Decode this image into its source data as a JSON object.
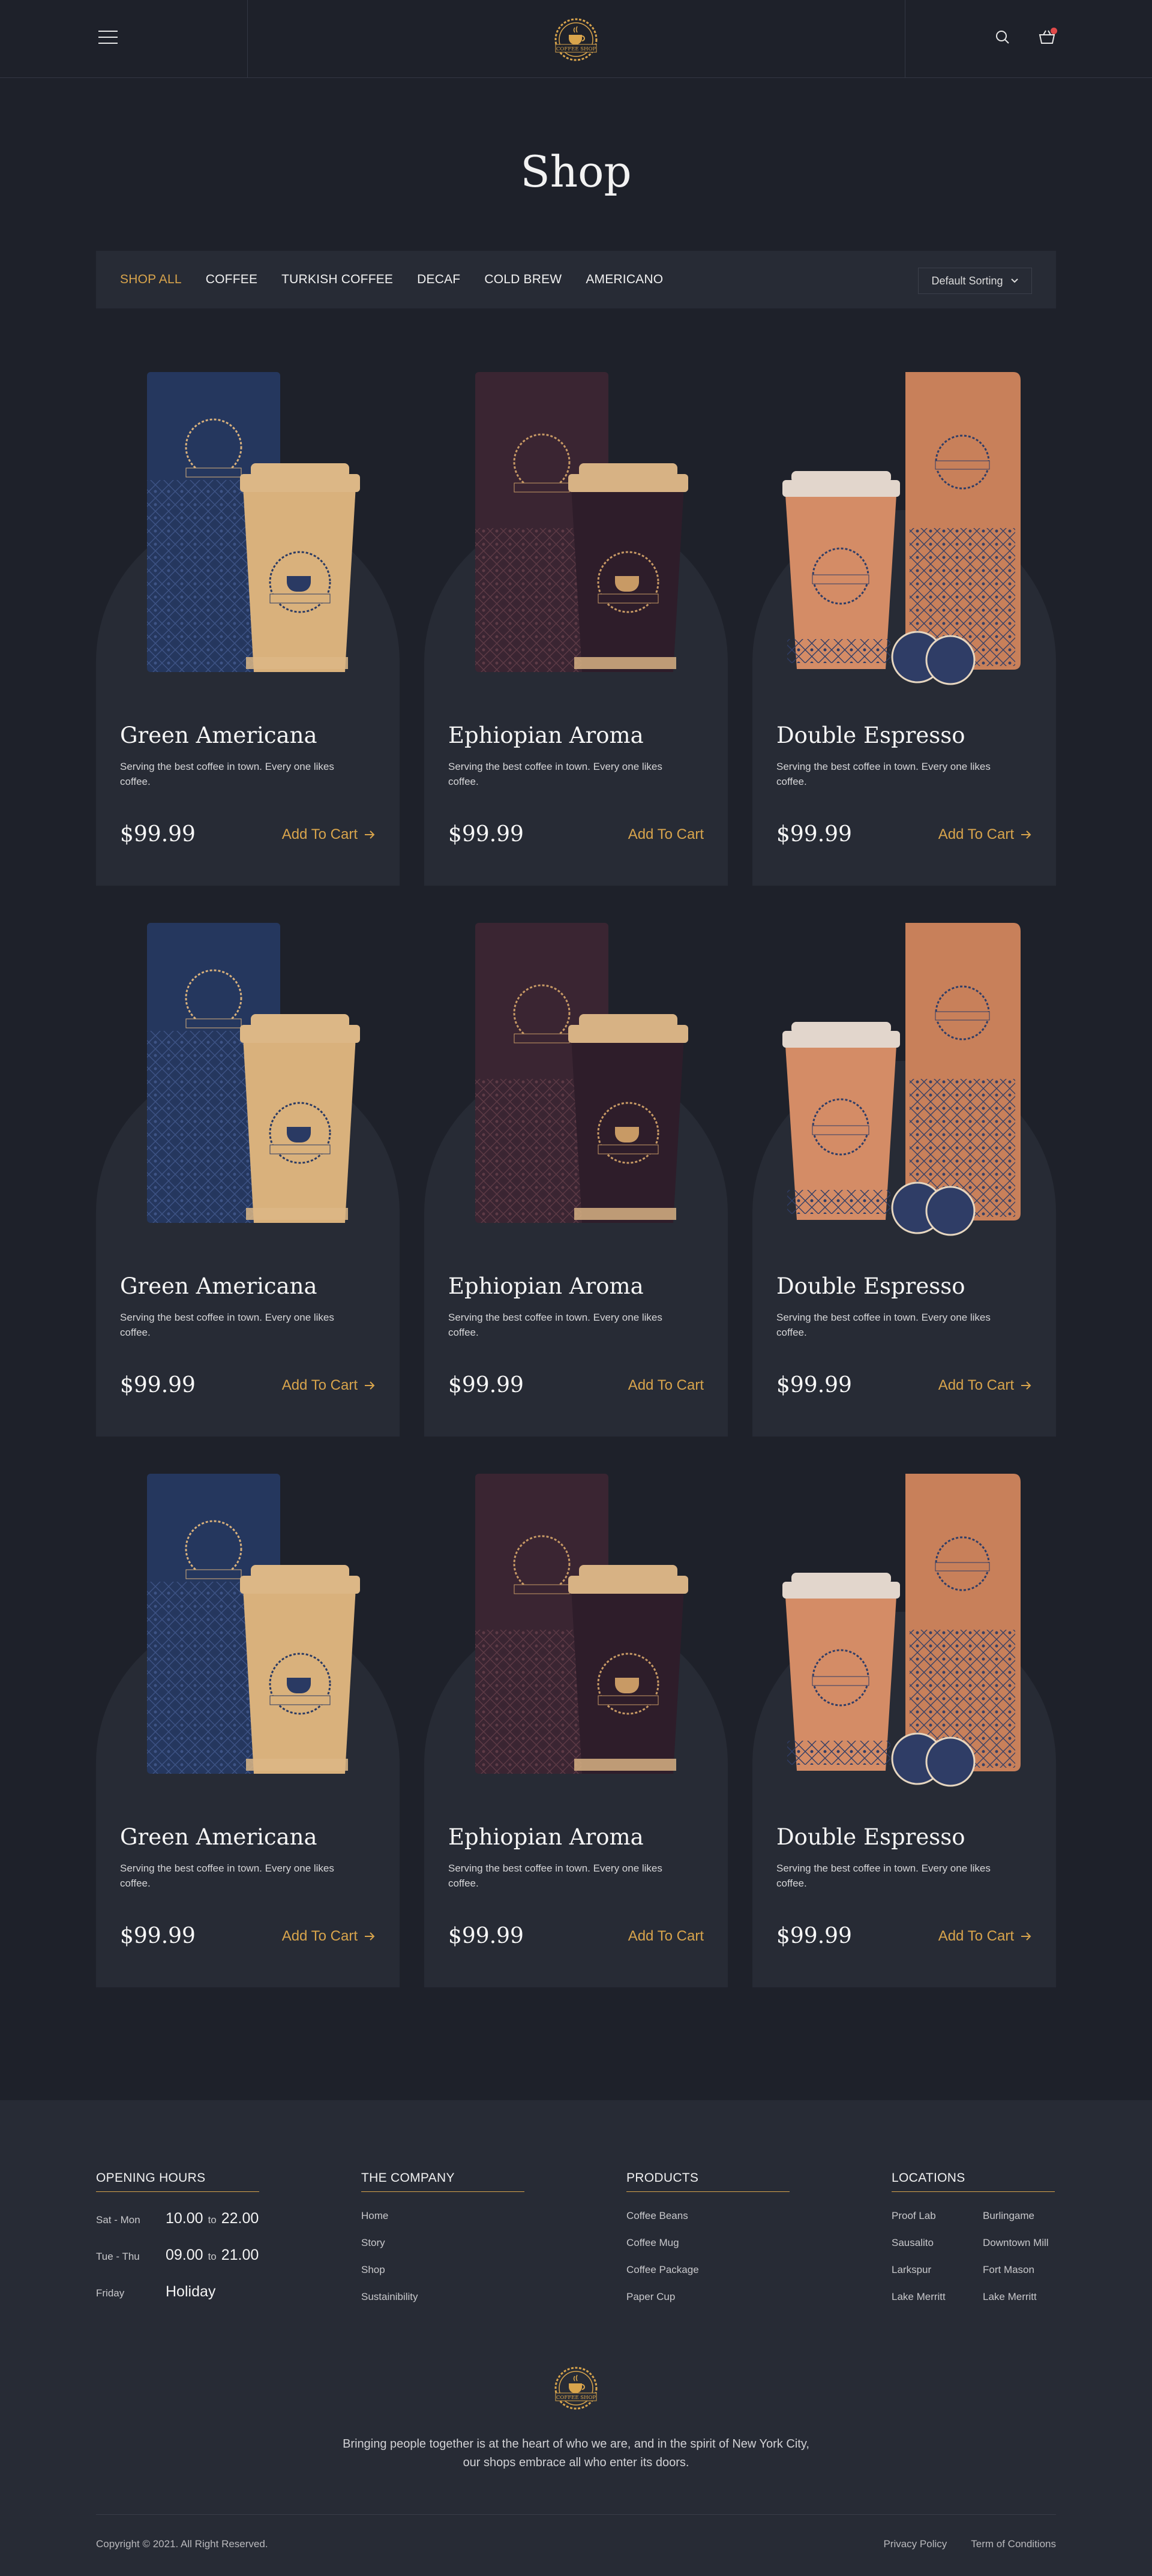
{
  "header": {
    "menu_icon": "hamburger-icon",
    "logo_text": "COFFEE SHOP",
    "search_icon": "search-icon",
    "cart_icon": "cart-icon"
  },
  "page_title": "Shop",
  "filters": {
    "tabs": [
      "SHOP ALL",
      "COFFEE",
      "TURKISH COFFEE",
      "DECAF",
      "COLD BREW",
      "AMERICANO"
    ],
    "active": "SHOP ALL",
    "sort_label": "Default Sorting"
  },
  "products": [
    {
      "name": "Green Americana",
      "desc": "Serving the best coffee in town. Every one likes coffee.",
      "price": "$99.99",
      "cta": "Add To Cart",
      "theme": "blue"
    },
    {
      "name": "Ephiopian Aroma",
      "desc": "Serving the best coffee in town. Every one likes coffee.",
      "price": "$99.99",
      "cta": "Add To Cart",
      "theme": "purple"
    },
    {
      "name": "Double Espresso",
      "desc": "Serving the best coffee in town. Every one likes coffee.",
      "price": "$99.99",
      "cta": "Add To Cart",
      "theme": "copper"
    },
    {
      "name": "Green Americana",
      "desc": "Serving the best coffee in town. Every one likes coffee.",
      "price": "$99.99",
      "cta": "Add To Cart",
      "theme": "blue"
    },
    {
      "name": "Ephiopian Aroma",
      "desc": "Serving the best coffee in town. Every one likes coffee.",
      "price": "$99.99",
      "cta": "Add To Cart",
      "theme": "purple"
    },
    {
      "name": "Double Espresso",
      "desc": "Serving the best coffee in town. Every one likes coffee.",
      "price": "$99.99",
      "cta": "Add To Cart",
      "theme": "copper"
    },
    {
      "name": "Green Americana",
      "desc": "Serving the best coffee in town. Every one likes coffee.",
      "price": "$99.99",
      "cta": "Add To Cart",
      "theme": "blue"
    },
    {
      "name": "Ephiopian Aroma",
      "desc": "Serving the best coffee in town. Every one likes coffee.",
      "price": "$99.99",
      "cta": "Add To Cart",
      "theme": "purple"
    },
    {
      "name": "Double Espresso",
      "desc": "Serving the best coffee in town. Every one likes coffee.",
      "price": "$99.99",
      "cta": "Add To Cart",
      "theme": "copper"
    }
  ],
  "footer": {
    "opening_hours": {
      "title": "OPENING HOURS",
      "rows": [
        {
          "day": "Sat - Mon",
          "from": "10.00",
          "to_label": "to",
          "to": "22.00"
        },
        {
          "day": "Tue - Thu",
          "from": "09.00",
          "to_label": "to",
          "to": "21.00"
        },
        {
          "day": "Friday",
          "from": "Holiday",
          "to_label": "",
          "to": ""
        }
      ]
    },
    "company": {
      "title": "THE COMPANY",
      "links": [
        "Home",
        "Story",
        "Shop",
        "Sustainibility"
      ]
    },
    "products": {
      "title": "PRODUCTS",
      "links": [
        "Coffee Beans",
        "Coffee Mug",
        "Coffee Package",
        "Paper Cup"
      ]
    },
    "locations": {
      "title": "LOCATIONS",
      "items": [
        "Proof Lab",
        "Burlingame",
        "Sausalito",
        "Downtown Mill",
        "Larkspur",
        "Fort Mason",
        "Lake Merritt",
        "Lake Merritt"
      ]
    },
    "logo_text": "COFFEE SHOP",
    "tagline": "Bringing people together is at the heart of who we are, and in the spirit of New York City, our shops embrace all who enter its doors.",
    "copyright": "Copyright © 2021. All Right Reserved.",
    "legal": [
      "Privacy Policy",
      "Term of Conditions"
    ]
  },
  "colors": {
    "background": "#1e212a",
    "card": "#272b35",
    "accent": "#d8a44c",
    "text": "#f1f1f1"
  }
}
